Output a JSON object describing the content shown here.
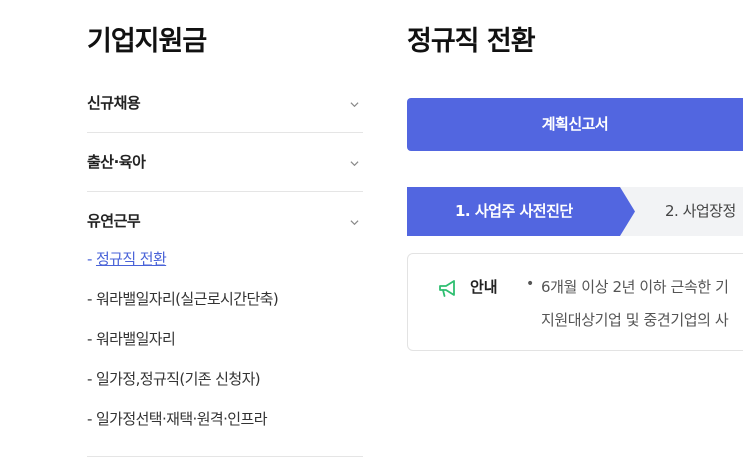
{
  "sidebar": {
    "title": "기업지원금",
    "sections": [
      {
        "label": "신규채용",
        "icon": "chevron-down-icon"
      },
      {
        "label": "출산·육아",
        "icon": "chevron-down-icon"
      },
      {
        "label": "유연근무",
        "icon": "chevron-down-icon"
      }
    ],
    "sub_items": [
      {
        "dash": "- ",
        "label": "정규직 전환",
        "active": true
      },
      {
        "dash": "- ",
        "label": "워라밸일자리(실근로시간단축)"
      },
      {
        "dash": "- ",
        "label": "워라밸일자리"
      },
      {
        "dash": "- ",
        "label": "일가정,정규직(기존 신청자)"
      },
      {
        "dash": "- ",
        "label": "일가정선택·재택·원격·인프라"
      }
    ]
  },
  "main": {
    "title": "정규직 전환",
    "primary_button": "계획신고서",
    "steps": [
      {
        "label": "1. 사업주 사전진단",
        "active": true
      },
      {
        "label": "2. 사업장정"
      }
    ],
    "notice": {
      "icon": "megaphone-icon",
      "label": "안내",
      "bullet": "•",
      "lines": [
        "6개월 이상 2년 이하 근속한 기",
        "지원대상기업 및 중견기업의 사"
      ]
    }
  },
  "colors": {
    "accent": "#5266e0",
    "link": "#4a63d8",
    "notice_icon": "#2fbf71",
    "step_bg": "#f2f3f5"
  }
}
